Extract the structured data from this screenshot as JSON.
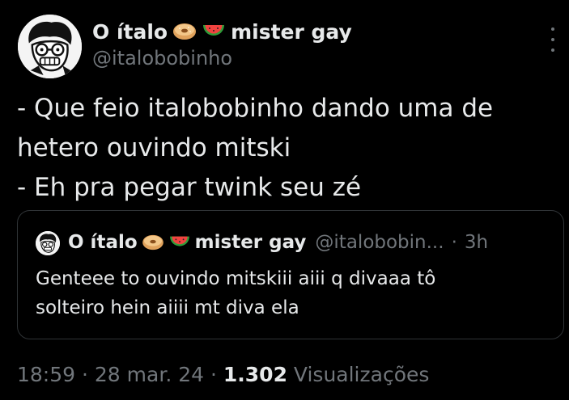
{
  "author": {
    "display_name": "O ítalo",
    "display_name_suffix": "mister gay",
    "handle": "@italobobinho",
    "emojis": [
      "bagel-icon",
      "watermelon-icon"
    ]
  },
  "tweet": {
    "lines": [
      "- Que feio italobobinho dando uma de",
      "hetero ouvindo mitski",
      "- Eh pra pegar twink seu zé"
    ]
  },
  "quote": {
    "display_name": "O ítalo",
    "display_name_suffix": "mister gay",
    "handle": "@italobobin...",
    "separator": "·",
    "time": "3h",
    "lines": [
      "Genteee to ouvindo mitskiii aiii q divaaa tô",
      "solteiro hein aiiii mt diva ela"
    ]
  },
  "meta": {
    "time": "18:59",
    "sep1": "·",
    "date": "28 mar. 24",
    "sep2": "·",
    "views_count": "1.302",
    "views_label": "Visualizações"
  },
  "colors": {
    "background": "#000000",
    "text": "#e7e9ea",
    "secondary": "#71767b",
    "border": "#2f3336"
  }
}
